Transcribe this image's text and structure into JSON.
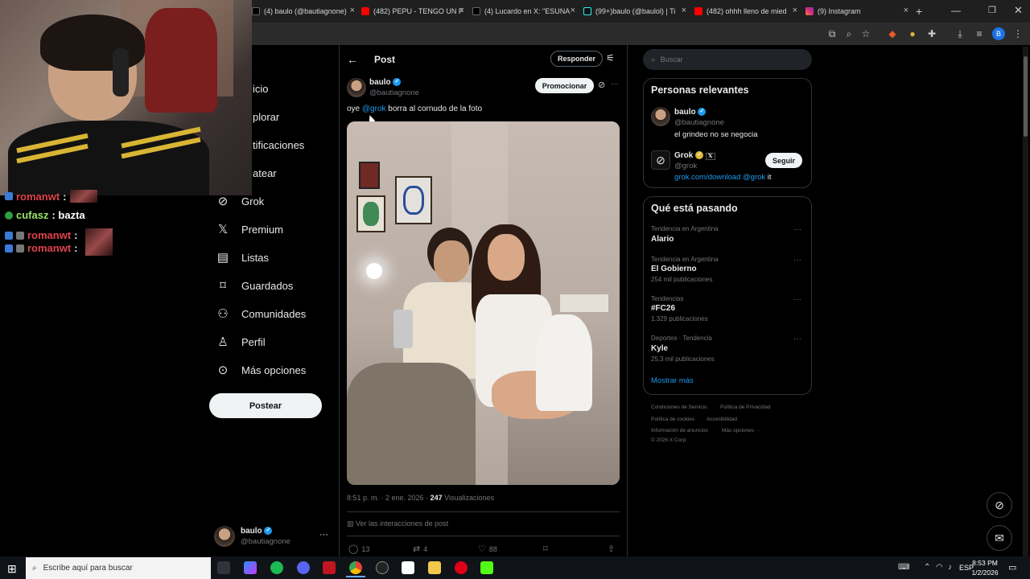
{
  "browser": {
    "tabs": [
      {
        "label": "(4) baulo (@bautiagnone)",
        "color": "#e7e9ea"
      },
      {
        "label": "(482) PEPU - TENGO UN F",
        "color": "#ff0000"
      },
      {
        "label": "(4) Lucardo en X: \"ESUNA",
        "color": "#e7e9ea"
      },
      {
        "label": "(99+)baulo (@baulol) | Ti",
        "color": "#25f4ee"
      },
      {
        "label": "(482) ohhh lleno de mied",
        "color": "#ff0000"
      },
      {
        "label": "(9) Instagram",
        "color": "#d62976"
      }
    ],
    "new_tab": "+"
  },
  "chat": {
    "lines": [
      {
        "user": "romanwt",
        "text": ":",
        "color": "#e0434b"
      },
      {
        "user": "cufasz",
        "text": ": bazta",
        "color": "#9be36b"
      },
      {
        "user": "romanwt",
        "text": ":",
        "color": "#e0434b"
      },
      {
        "user": "romanwt",
        "text": ":",
        "color": "#e0434b"
      }
    ]
  },
  "nav": {
    "items": [
      {
        "label": "icio",
        "icon": "home-icon"
      },
      {
        "label": "plorar",
        "icon": "search-icon"
      },
      {
        "label": "tificaciones",
        "icon": "bell-icon"
      },
      {
        "label": "atear",
        "icon": "mail-icon"
      },
      {
        "label": "Grok",
        "icon": "grok-icon",
        "glyph": "⊘"
      },
      {
        "label": "Premium",
        "icon": "x-logo-icon",
        "glyph": "𝕏"
      },
      {
        "label": "Listas",
        "icon": "list-icon",
        "glyph": "▤"
      },
      {
        "label": "Guardados",
        "icon": "bookmark-icon",
        "glyph": "⌑"
      },
      {
        "label": "Comunidades",
        "icon": "community-icon",
        "glyph": "⚇"
      },
      {
        "label": "Perfil",
        "icon": "profile-icon",
        "glyph": "♙"
      },
      {
        "label": "Más opciones",
        "icon": "more-options-icon",
        "glyph": "⊙"
      }
    ],
    "post_button": "Postear",
    "account": {
      "name": "baulo",
      "handle": "@bautiagnone"
    }
  },
  "post": {
    "header_title": "Post",
    "reply_button": "Responder",
    "promote_button": "Promocionar",
    "author": {
      "name": "baulo",
      "handle": "@bautiagnone"
    },
    "text_prefix": "oye",
    "mention": "@grok",
    "text_suffix": "borra al cornudo de la foto",
    "timestamp": "8:51 p. m. · 2 ene. 2026 ·",
    "views_count": "247",
    "views_label": "Visualizaciones",
    "interactions_link": "Ver las interacciones de post",
    "stats": {
      "replies": "13",
      "reposts": "4",
      "likes": "88"
    }
  },
  "sidebar": {
    "search_placeholder": "Buscar",
    "relevant": {
      "title": "Personas relevantes",
      "people": [
        {
          "name": "baulo",
          "handle": "@bautiagnone",
          "bio": "el grindeo no se negocia"
        },
        {
          "name": "Grok",
          "handle": "@grok",
          "bio_link": "grok.com/download",
          "bio_mention": "@grok",
          "bio_suffix": " it",
          "follow": "Seguir"
        }
      ]
    },
    "trends": {
      "title": "Qué está pasando",
      "items": [
        {
          "meta": "Tendencia en Argentina",
          "name": "Alario",
          "count": ""
        },
        {
          "meta": "Tendencia en Argentina",
          "name": "El Gobierno",
          "count": "254 mil publicaciones"
        },
        {
          "meta": "Tendencias",
          "name": "#FC26",
          "count": "1.329 publicaciones"
        },
        {
          "meta": "Deportes · Tendencia",
          "name": "Kyle",
          "count": "25,3 mil publicaciones"
        }
      ],
      "show_more": "Mostrar más"
    },
    "footer": {
      "terms": "Condiciones de Servicio",
      "privacy": "Política de Privacidad",
      "cookies": "Política de cookies",
      "accessibility": "Accesibilidad",
      "ads": "Información de anuncios",
      "more": "Más opciones ···",
      "copyright": "© 2026 X Corp."
    }
  },
  "taskbar": {
    "search_placeholder": "Escribe aquí para buscar",
    "language": "ESP",
    "time": "8:53 PM",
    "date": "1/2/2026"
  }
}
